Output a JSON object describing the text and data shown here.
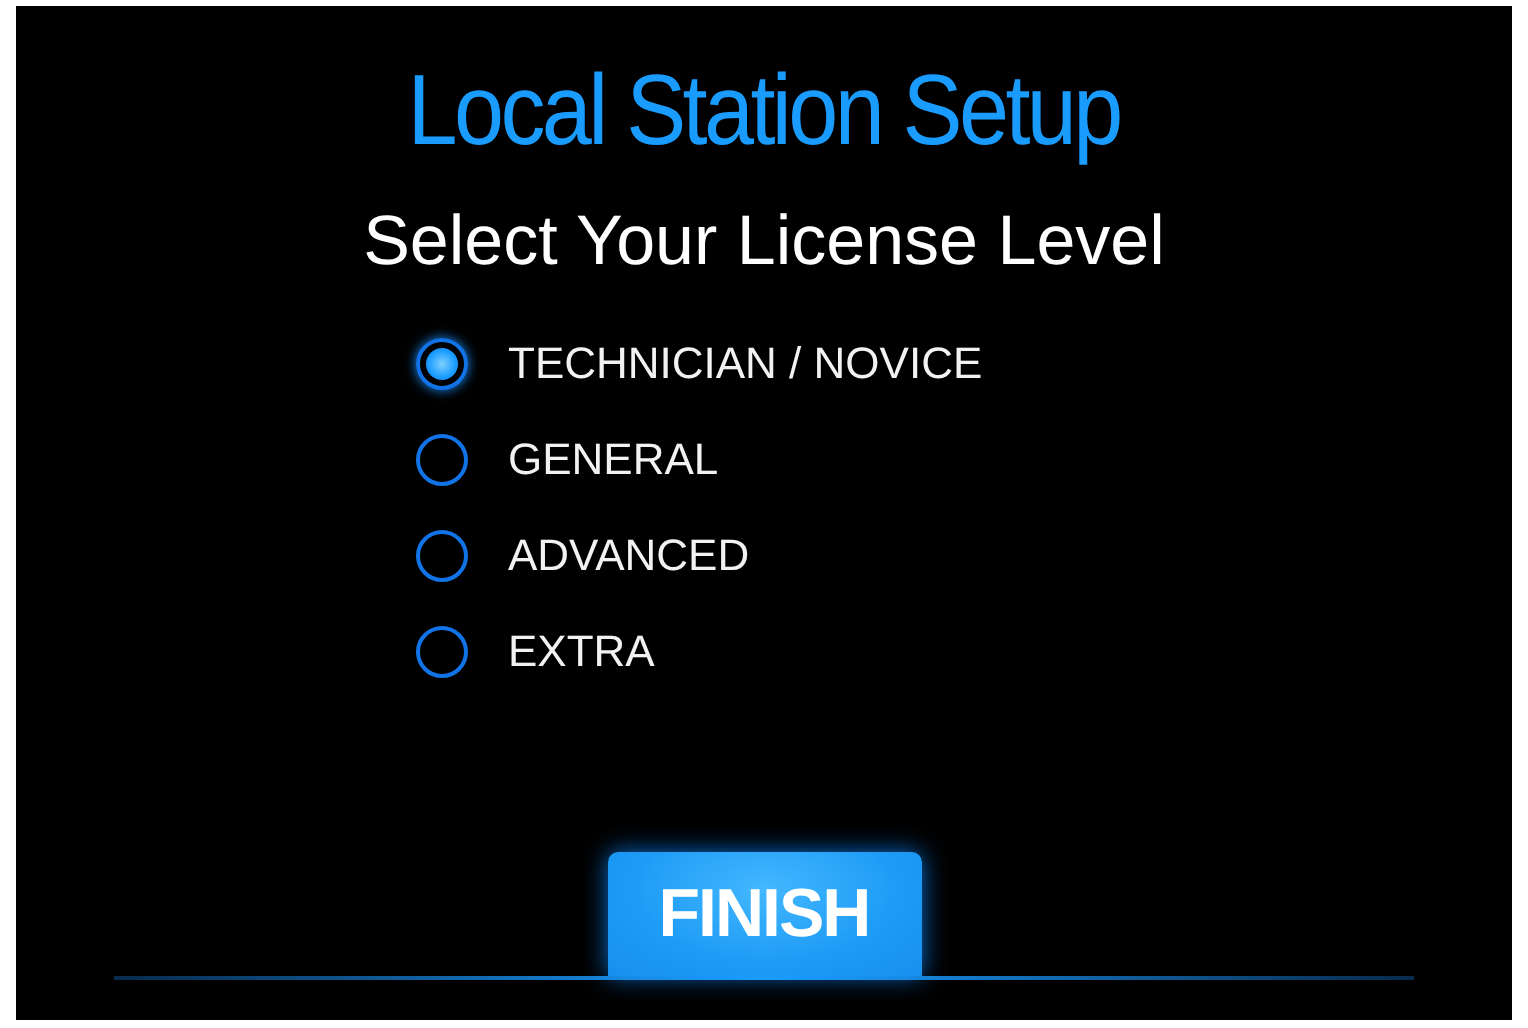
{
  "title": "Local Station Setup",
  "heading": "Select Your License Level",
  "options": [
    {
      "label": "TECHNICIAN / NOVICE",
      "selected": true
    },
    {
      "label": "GENERAL",
      "selected": false
    },
    {
      "label": "ADVANCED",
      "selected": false
    },
    {
      "label": "EXTRA",
      "selected": false
    }
  ],
  "button": "FINISH"
}
